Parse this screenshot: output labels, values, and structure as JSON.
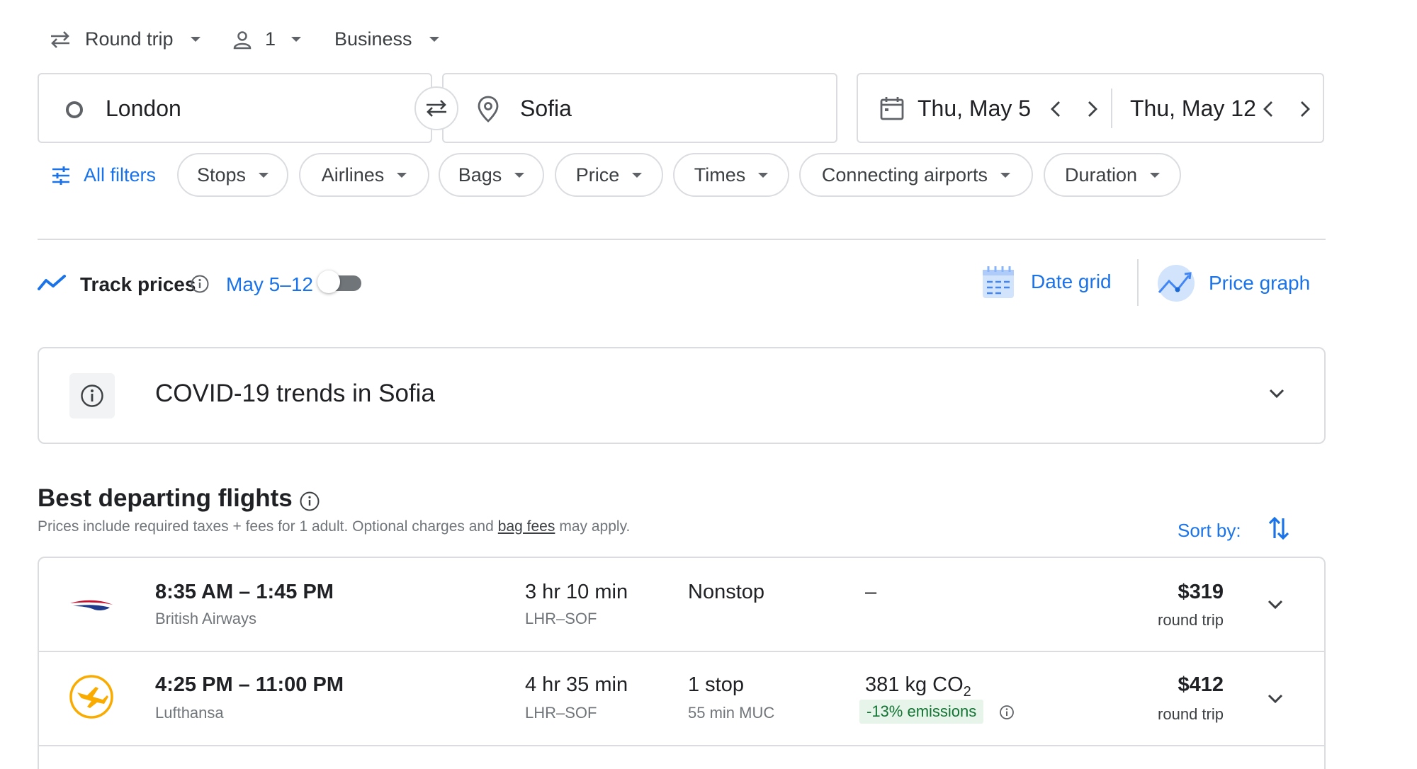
{
  "top": {
    "trip_type": "Round trip",
    "passengers": "1",
    "cabin": "Business"
  },
  "search": {
    "origin": "London",
    "destination": "Sofia",
    "depart_date": "Thu, May 5",
    "return_date": "Thu, May 12"
  },
  "filters": {
    "all_filters": "All filters",
    "chips": [
      "Stops",
      "Airlines",
      "Bags",
      "Price",
      "Times",
      "Connecting airports",
      "Duration"
    ]
  },
  "track": {
    "label": "Track prices",
    "dates": "May 5–12",
    "enabled": false
  },
  "views": {
    "date_grid": "Date grid",
    "price_graph": "Price graph"
  },
  "covid": {
    "title": "COVID-19 trends in Sofia"
  },
  "results": {
    "heading": "Best departing flights",
    "note_pre": "Prices include required taxes + fees for 1 adult. Optional charges and",
    "note_link": "bag fees",
    "note_post": "may apply.",
    "sort_label": "Sort by:",
    "flights": [
      {
        "times": "8:35 AM – 1:45 PM",
        "airline": "British Airways",
        "duration": "3 hr 10 min",
        "route": "LHR–SOF",
        "stops": "Nonstop",
        "stop_detail": "",
        "emissions": "–",
        "emissions_badge": "",
        "price": "$319",
        "price_note": "round trip"
      },
      {
        "times": "4:25 PM – 11:00 PM",
        "airline": "Lufthansa",
        "duration": "4 hr 35 min",
        "route": "LHR–SOF",
        "stops": "1 stop",
        "stop_detail": "55 min MUC",
        "emissions": "381 kg CO",
        "emissions_sub": "2",
        "emissions_badge": "-13% emissions",
        "price": "$412",
        "price_note": "round trip"
      }
    ]
  },
  "colors": {
    "accent": "#1a73e8",
    "price_good": "#188038",
    "emissions_badge_bg": "#e6f4ea"
  }
}
